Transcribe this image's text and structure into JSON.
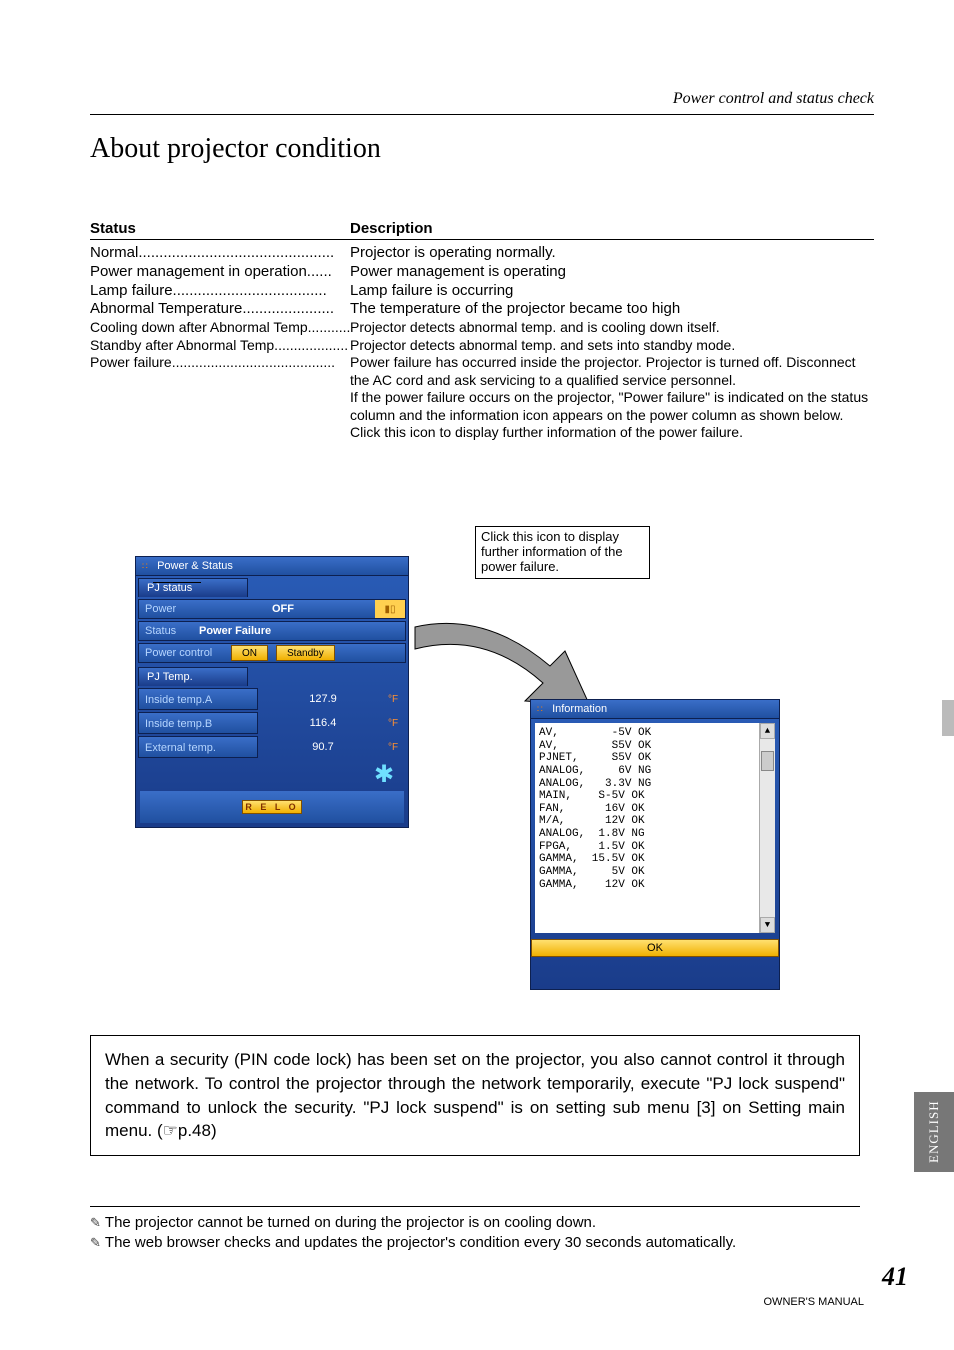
{
  "header": "Power control and status  check",
  "title": "About projector condition",
  "table_headers": {
    "status": "Status",
    "desc": "Description"
  },
  "rows": [
    {
      "status": "Normal",
      "desc": "Projector is operating normally.",
      "dots": "..............................................."
    },
    {
      "status": "Power management in operation",
      "desc": "Power management is operating",
      "dots": "......"
    },
    {
      "status": "Lamp failure",
      "desc": "Lamp failure is occurring",
      "dots": "....................................."
    },
    {
      "status": "Abnormal Temperature",
      "desc": "The temperature of the projector became too high",
      "dots": "......................"
    },
    {
      "status": "Cooling down after Abnormal Temp.",
      "desc": "Projector detects abnormal temp. and is cooling down itself.",
      "dots": "............",
      "small": true
    },
    {
      "status": "Standby after Abnormal Temp.",
      "desc": "Projector detects abnormal temp. and sets into standby mode.",
      "dots": "..................",
      "small": true
    },
    {
      "status": "Power failure",
      "desc": "Power failure has occurred inside the projector. Projector is turned off. Disconnect the AC cord and ask servicing to a qualified service personnel.\nIf the power failure occurs on the projector,  \"Power failure\" is indicated on the status column and the information icon appears on the power column as shown below. Click this icon to display further information of the power failure.",
      "dots": "..........................................",
      "small": true,
      "multi": true
    }
  ],
  "callout": "Click this icon to display further information of the power failure.",
  "panel": {
    "title": "Power & Status",
    "tab1": "PJ status",
    "power_lbl": "Power",
    "power_val": "OFF",
    "status_lbl": "Status",
    "status_val": "Power Failure",
    "pc_lbl": "Power control",
    "on": "ON",
    "standby": "Standby",
    "tab2": "PJ Temp.",
    "temps": [
      {
        "lbl": "Inside temp.A",
        "val": "127.9",
        "unit": "°F"
      },
      {
        "lbl": "Inside temp.B",
        "val": "116.4",
        "unit": "°F"
      },
      {
        "lbl": "External temp.",
        "val": "90.7",
        "unit": "°F"
      }
    ],
    "relo": "R  E  L  O"
  },
  "info": {
    "title": "Information",
    "lines": [
      "AV,        -5V OK",
      "AV,        S5V OK",
      "PJNET,     S5V OK",
      "ANALOG,     6V NG",
      "ANALOG,   3.3V NG",
      "MAIN,    S-5V OK",
      "FAN,      16V OK",
      "M/A,      12V OK",
      "ANALOG,  1.8V NG",
      "FPGA,    1.5V OK",
      "GAMMA,  15.5V OK",
      "GAMMA,     5V OK",
      "GAMMA,    12V OK"
    ],
    "ok": "OK"
  },
  "note": "When a security (PIN code lock) has been set on the projector, you also cannot control it through the network. To control the projector through the network temporarily, execute \"PJ lock suspend\" command to unlock the security. \"PJ lock suspend\" is on setting sub menu [3] on Setting main menu. (☞p.48)",
  "foot1": "The projector cannot be turned on during the projector is on cooling down.",
  "foot2": "The web browser checks and updates the projector's condition every 30 seconds automatically.",
  "page_num": "41",
  "owner": "OWNER'S MANUAL",
  "lang": "ENGLISH"
}
